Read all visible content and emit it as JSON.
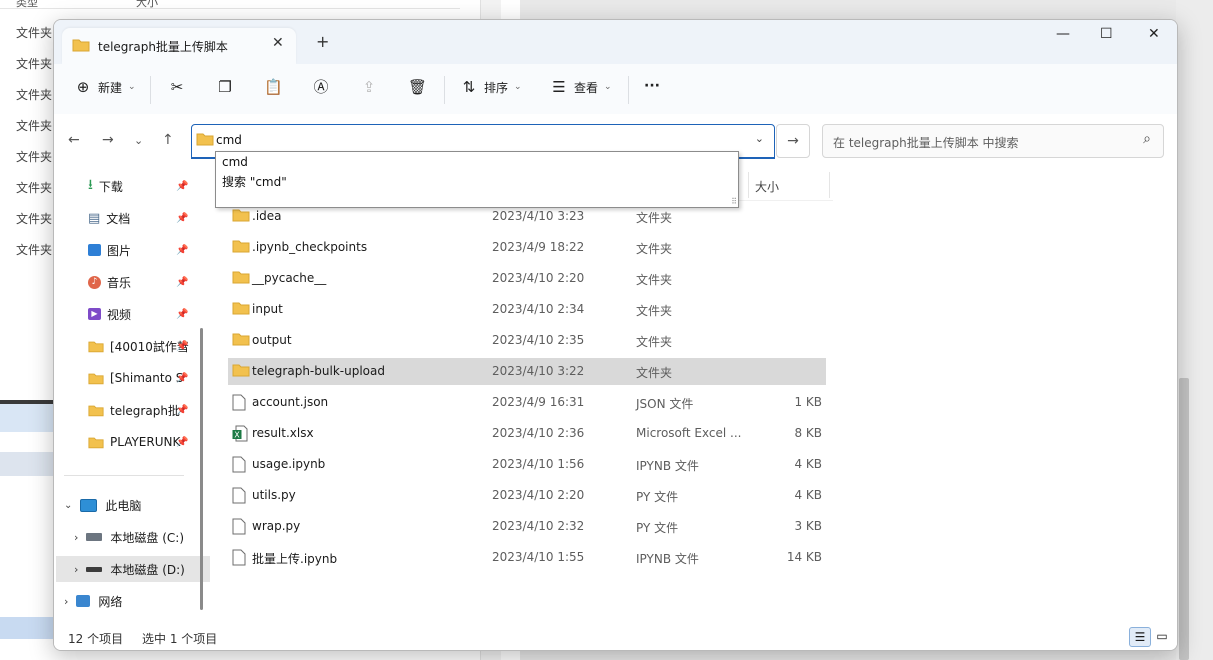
{
  "background_window": {
    "header_type": "类型",
    "header_size": "大小",
    "rows": [
      "文件夹",
      "文件夹",
      "文件夹",
      "文件夹",
      "文件夹",
      "文件夹",
      "文件夹",
      "文件夹"
    ]
  },
  "tab": {
    "title": "telegraph批量上传脚本",
    "close": "✕",
    "new_tab": "+"
  },
  "window_controls": {
    "minimize": "—",
    "maximize": "☐",
    "close": "✕"
  },
  "toolbar": {
    "new_label": "新建",
    "sort_label": "排序",
    "view_label": "查看",
    "more": "···"
  },
  "address": {
    "value": "cmd"
  },
  "search": {
    "placeholder": "在 telegraph批量上传脚本 中搜索"
  },
  "autocomplete": {
    "items": [
      "cmd",
      "搜索 \"cmd\""
    ]
  },
  "sidebar": {
    "quick": [
      {
        "label": "下载",
        "icon": "download-icon"
      },
      {
        "label": "文档",
        "icon": "document-icon"
      },
      {
        "label": "图片",
        "icon": "pictures-icon"
      },
      {
        "label": "音乐",
        "icon": "music-icon"
      },
      {
        "label": "视频",
        "icon": "video-icon"
      },
      {
        "label": "[40010試作彗",
        "icon": "folder-icon"
      },
      {
        "label": "[Shimanto S",
        "icon": "folder-icon"
      },
      {
        "label": "telegraph批",
        "icon": "folder-icon"
      },
      {
        "label": "PLAYERUNK",
        "icon": "folder-icon"
      }
    ],
    "this_pc": "此电脑",
    "drive_c": "本地磁盘 (C:)",
    "drive_d": "本地磁盘 (D:)",
    "network": "网络"
  },
  "columns": {
    "size": "大小"
  },
  "files": [
    {
      "name": ".idea",
      "date": "2023/4/10 3:23",
      "type": "文件夹",
      "size": "",
      "kind": "folder"
    },
    {
      "name": ".ipynb_checkpoints",
      "date": "2023/4/9 18:22",
      "type": "文件夹",
      "size": "",
      "kind": "folder"
    },
    {
      "name": "__pycache__",
      "date": "2023/4/10 2:20",
      "type": "文件夹",
      "size": "",
      "kind": "folder"
    },
    {
      "name": "input",
      "date": "2023/4/10 2:34",
      "type": "文件夹",
      "size": "",
      "kind": "folder"
    },
    {
      "name": "output",
      "date": "2023/4/10 2:35",
      "type": "文件夹",
      "size": "",
      "kind": "folder"
    },
    {
      "name": "telegraph-bulk-upload",
      "date": "2023/4/10 3:22",
      "type": "文件夹",
      "size": "",
      "kind": "folder"
    },
    {
      "name": "account.json",
      "date": "2023/4/9 16:31",
      "type": "JSON 文件",
      "size": "1 KB",
      "kind": "file"
    },
    {
      "name": "result.xlsx",
      "date": "2023/4/10 2:36",
      "type": "Microsoft Excel ...",
      "size": "8 KB",
      "kind": "excel"
    },
    {
      "name": "usage.ipynb",
      "date": "2023/4/10 1:56",
      "type": "IPYNB 文件",
      "size": "4 KB",
      "kind": "file"
    },
    {
      "name": "utils.py",
      "date": "2023/4/10 2:20",
      "type": "PY 文件",
      "size": "4 KB",
      "kind": "file"
    },
    {
      "name": "wrap.py",
      "date": "2023/4/10 2:32",
      "type": "PY 文件",
      "size": "3 KB",
      "kind": "file"
    },
    {
      "name": "批量上传.ipynb",
      "date": "2023/4/10 1:55",
      "type": "IPYNB 文件",
      "size": "14 KB",
      "kind": "file"
    }
  ],
  "status": {
    "count": "12 个项目",
    "selected": "选中 1 个项目"
  },
  "colors": {
    "accent": "#1e63b8",
    "folder": "#f2c14e",
    "selected_row": "#d9d9d9"
  }
}
